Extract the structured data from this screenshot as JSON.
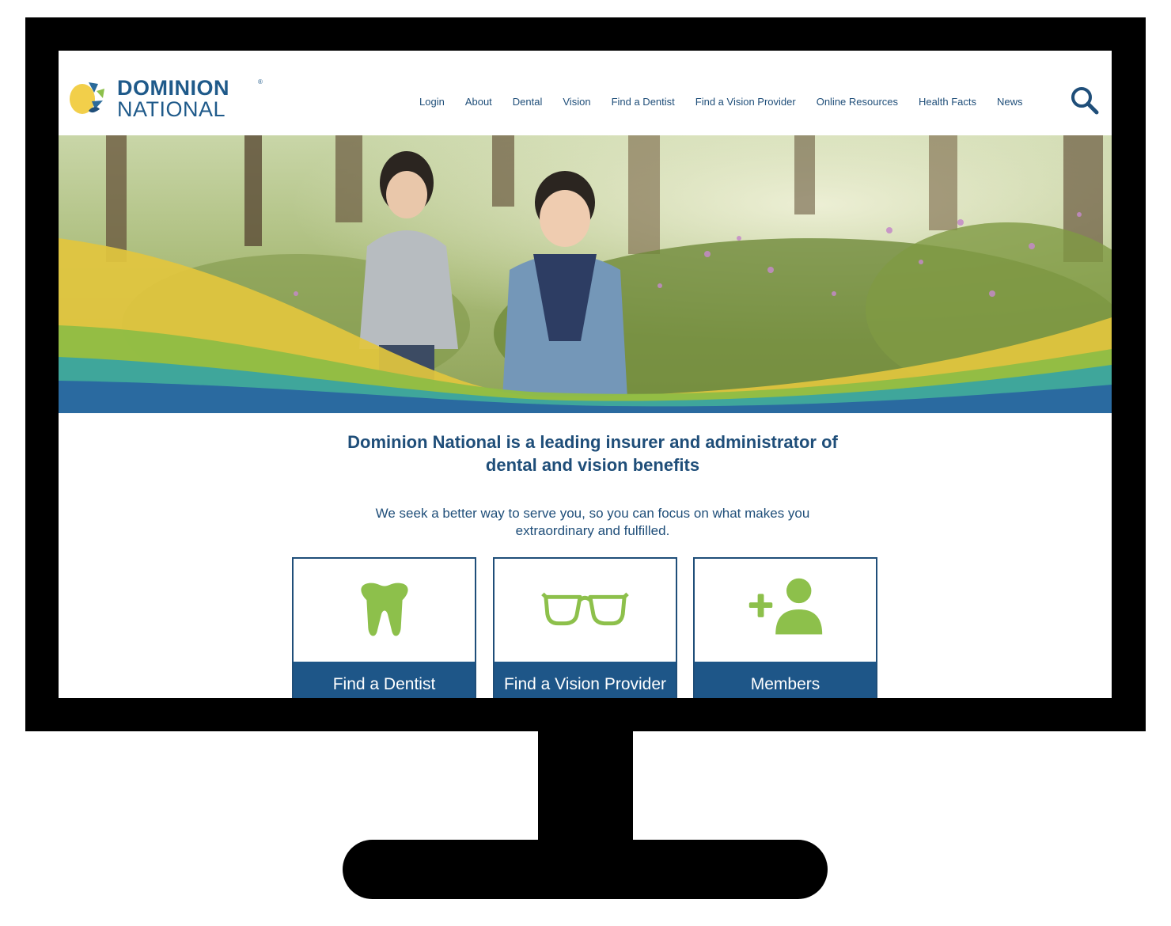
{
  "brand": {
    "name_line1": "DOMINION",
    "name_line2": "NATIONAL",
    "registered": "®",
    "color_primary": "#1f4e79",
    "color_accent": "#8dc04b",
    "color_logo_yellow": "#f2cf4a"
  },
  "nav": {
    "items": [
      {
        "label": "Login"
      },
      {
        "label": "About"
      },
      {
        "label": "Dental"
      },
      {
        "label": "Vision"
      },
      {
        "label": "Find a Dentist"
      },
      {
        "label": "Find a Vision Provider"
      },
      {
        "label": "Online Resources"
      },
      {
        "label": "Health Facts"
      },
      {
        "label": "News"
      }
    ],
    "search_icon": "search-icon"
  },
  "hero": {
    "image_description_icon": "photo-children-running"
  },
  "main": {
    "headline_line1": "Dominion National is a leading insurer and administrator of",
    "headline_line2": "dental and vision benefits",
    "subline_line1": "We seek a better way to serve you, so you can focus on what makes you",
    "subline_line2": "extraordinary and fulfilled."
  },
  "cards": [
    {
      "label": "Find a Dentist",
      "icon": "tooth-icon"
    },
    {
      "label": "Find a Vision Provider",
      "icon": "glasses-icon"
    },
    {
      "label": "Members",
      "icon": "add-user-icon"
    }
  ]
}
